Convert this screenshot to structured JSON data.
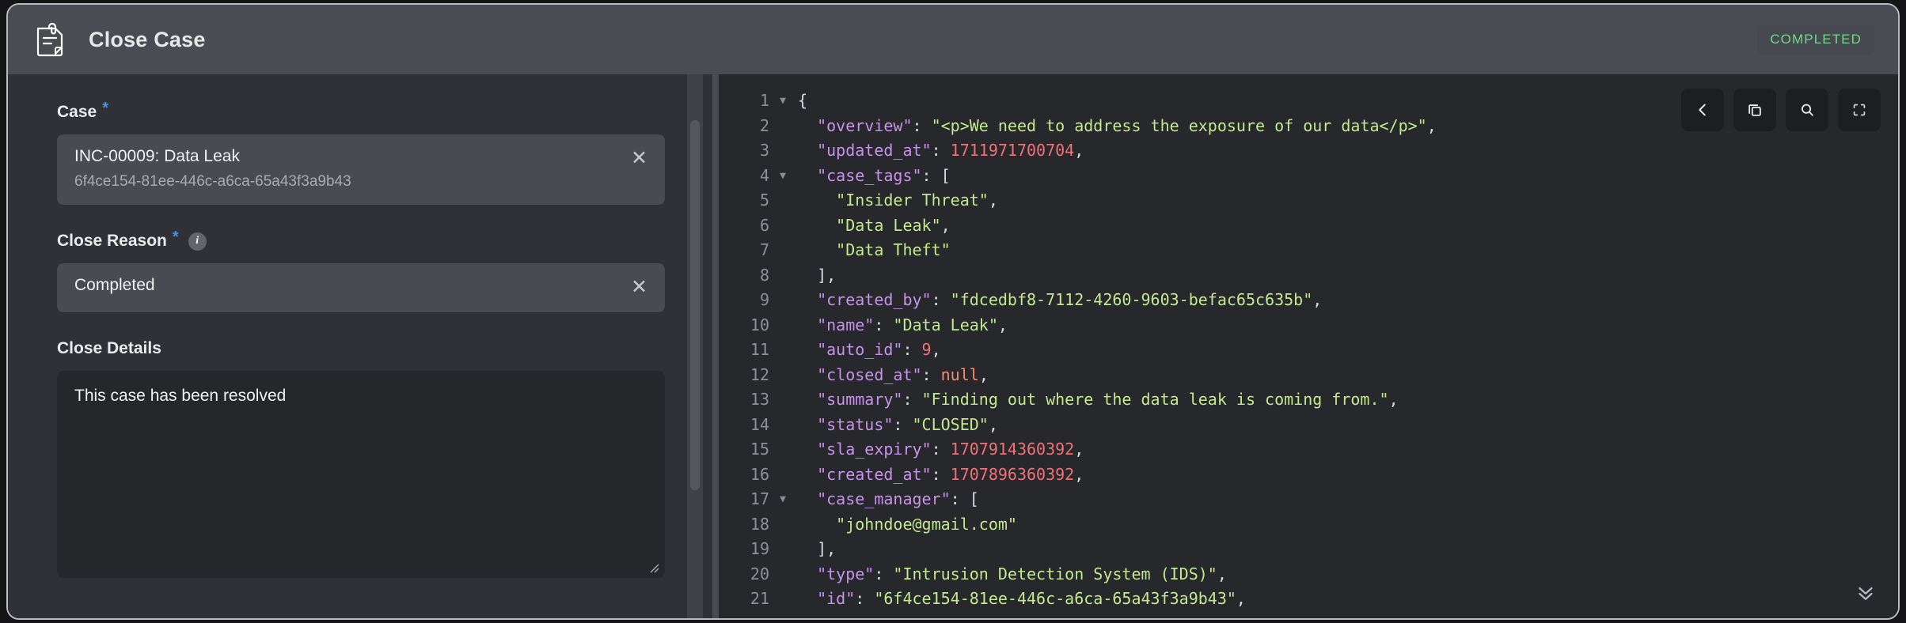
{
  "header": {
    "icon": "case-document-icon",
    "title": "Close Case",
    "status_badge": "COMPLETED",
    "badge_color": "#74d68a",
    "bar_color": "#4a4b53"
  },
  "form": {
    "case_field": {
      "label": "Case",
      "required_marker": "*",
      "value_primary": "INC-00009: Data Leak",
      "value_secondary": "6f4ce154-81ee-446c-a6ca-65a43f3a9b43",
      "clear_icon": "close-x-icon"
    },
    "close_reason_field": {
      "label": "Close Reason",
      "required_marker": "*",
      "info_icon": "info-icon",
      "info_glyph": "i",
      "value": "Completed",
      "clear_icon": "close-x-icon"
    },
    "close_details_field": {
      "label": "Close Details",
      "value": "This case has been resolved",
      "placeholder": ""
    },
    "required_color": "#4a90e2"
  },
  "json_viewer": {
    "toolbar": [
      {
        "name": "collapse-all-button",
        "icon": "chevron-left-icon"
      },
      {
        "name": "copy-button",
        "icon": "copy-icon"
      },
      {
        "name": "search-button",
        "icon": "search-icon"
      },
      {
        "name": "fullscreen-button",
        "icon": "fullscreen-icon"
      }
    ],
    "expand_button": {
      "name": "expand-more-button",
      "icon": "chevrons-down-icon"
    },
    "colors": {
      "key": "#c792ea",
      "string": "#c3e88d",
      "number": "#f07178",
      "null": "#f78c6c",
      "punctuation": "#d8dce3",
      "line_number": "#8d9096",
      "background": "#27282c"
    },
    "lines": [
      {
        "num": "1",
        "fold": "▼",
        "tokens": [
          {
            "t": "{",
            "c": "p"
          }
        ]
      },
      {
        "num": "2",
        "fold": "",
        "tokens": [
          {
            "t": "  \"overview\"",
            "c": "k"
          },
          {
            "t": ": ",
            "c": "p"
          },
          {
            "t": "\"<p>We need to address the exposure of our data</p>\"",
            "c": "s"
          },
          {
            "t": ",",
            "c": "p"
          }
        ]
      },
      {
        "num": "3",
        "fold": "",
        "tokens": [
          {
            "t": "  \"updated_at\"",
            "c": "k"
          },
          {
            "t": ": ",
            "c": "p"
          },
          {
            "t": "1711971700704",
            "c": "n"
          },
          {
            "t": ",",
            "c": "p"
          }
        ]
      },
      {
        "num": "4",
        "fold": "▼",
        "tokens": [
          {
            "t": "  \"case_tags\"",
            "c": "k"
          },
          {
            "t": ": [",
            "c": "p"
          }
        ]
      },
      {
        "num": "5",
        "fold": "",
        "tokens": [
          {
            "t": "    ",
            "c": "p"
          },
          {
            "t": "\"Insider Threat\"",
            "c": "s"
          },
          {
            "t": ",",
            "c": "p"
          }
        ]
      },
      {
        "num": "6",
        "fold": "",
        "tokens": [
          {
            "t": "    ",
            "c": "p"
          },
          {
            "t": "\"Data Leak\"",
            "c": "s"
          },
          {
            "t": ",",
            "c": "p"
          }
        ]
      },
      {
        "num": "7",
        "fold": "",
        "tokens": [
          {
            "t": "    ",
            "c": "p"
          },
          {
            "t": "\"Data Theft\"",
            "c": "s"
          }
        ]
      },
      {
        "num": "8",
        "fold": "",
        "tokens": [
          {
            "t": "  ],",
            "c": "p"
          }
        ]
      },
      {
        "num": "9",
        "fold": "",
        "tokens": [
          {
            "t": "  \"created_by\"",
            "c": "k"
          },
          {
            "t": ": ",
            "c": "p"
          },
          {
            "t": "\"fdcedbf8-7112-4260-9603-befac65c635b\"",
            "c": "s"
          },
          {
            "t": ",",
            "c": "p"
          }
        ]
      },
      {
        "num": "10",
        "fold": "",
        "tokens": [
          {
            "t": "  \"name\"",
            "c": "k"
          },
          {
            "t": ": ",
            "c": "p"
          },
          {
            "t": "\"Data Leak\"",
            "c": "s"
          },
          {
            "t": ",",
            "c": "p"
          }
        ]
      },
      {
        "num": "11",
        "fold": "",
        "tokens": [
          {
            "t": "  \"auto_id\"",
            "c": "k"
          },
          {
            "t": ": ",
            "c": "p"
          },
          {
            "t": "9",
            "c": "n"
          },
          {
            "t": ",",
            "c": "p"
          }
        ]
      },
      {
        "num": "12",
        "fold": "",
        "tokens": [
          {
            "t": "  \"closed_at\"",
            "c": "k"
          },
          {
            "t": ": ",
            "c": "p"
          },
          {
            "t": "null",
            "c": "nu"
          },
          {
            "t": ",",
            "c": "p"
          }
        ]
      },
      {
        "num": "13",
        "fold": "",
        "tokens": [
          {
            "t": "  \"summary\"",
            "c": "k"
          },
          {
            "t": ": ",
            "c": "p"
          },
          {
            "t": "\"Finding out where the data leak is coming from.\"",
            "c": "s"
          },
          {
            "t": ",",
            "c": "p"
          }
        ]
      },
      {
        "num": "14",
        "fold": "",
        "tokens": [
          {
            "t": "  \"status\"",
            "c": "k"
          },
          {
            "t": ": ",
            "c": "p"
          },
          {
            "t": "\"CLOSED\"",
            "c": "s"
          },
          {
            "t": ",",
            "c": "p"
          }
        ]
      },
      {
        "num": "15",
        "fold": "",
        "tokens": [
          {
            "t": "  \"sla_expiry\"",
            "c": "k"
          },
          {
            "t": ": ",
            "c": "p"
          },
          {
            "t": "1707914360392",
            "c": "n"
          },
          {
            "t": ",",
            "c": "p"
          }
        ]
      },
      {
        "num": "16",
        "fold": "",
        "tokens": [
          {
            "t": "  \"created_at\"",
            "c": "k"
          },
          {
            "t": ": ",
            "c": "p"
          },
          {
            "t": "1707896360392",
            "c": "n"
          },
          {
            "t": ",",
            "c": "p"
          }
        ]
      },
      {
        "num": "17",
        "fold": "▼",
        "tokens": [
          {
            "t": "  \"case_manager\"",
            "c": "k"
          },
          {
            "t": ": [",
            "c": "p"
          }
        ]
      },
      {
        "num": "18",
        "fold": "",
        "tokens": [
          {
            "t": "    ",
            "c": "p"
          },
          {
            "t": "\"johndoe@gmail.com\"",
            "c": "s"
          }
        ]
      },
      {
        "num": "19",
        "fold": "",
        "tokens": [
          {
            "t": "  ],",
            "c": "p"
          }
        ]
      },
      {
        "num": "20",
        "fold": "",
        "tokens": [
          {
            "t": "  \"type\"",
            "c": "k"
          },
          {
            "t": ": ",
            "c": "p"
          },
          {
            "t": "\"Intrusion Detection System (IDS)\"",
            "c": "s"
          },
          {
            "t": ",",
            "c": "p"
          }
        ]
      },
      {
        "num": "21",
        "fold": "",
        "tokens": [
          {
            "t": "  \"id\"",
            "c": "k"
          },
          {
            "t": ": ",
            "c": "p"
          },
          {
            "t": "\"6f4ce154-81ee-446c-a6ca-65a43f3a9b43\"",
            "c": "s"
          },
          {
            "t": ",",
            "c": "p"
          }
        ]
      }
    ]
  }
}
